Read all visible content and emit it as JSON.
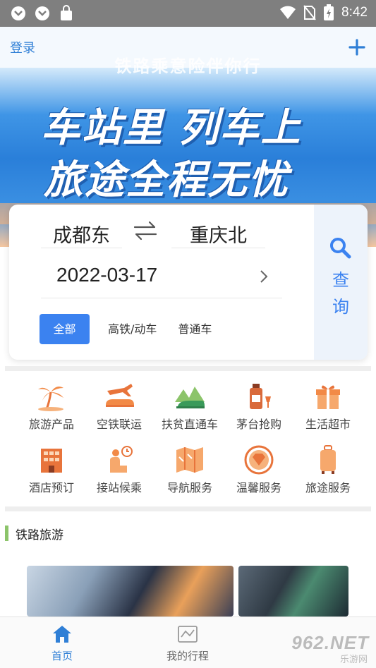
{
  "status_bar": {
    "time": "8:42"
  },
  "header": {
    "login_label": "登录"
  },
  "banner": {
    "tagline": "铁路乘意险伴你行",
    "slogan_line1": "车站里 列车上",
    "slogan_line2": "旅途全程无忧"
  },
  "search": {
    "from_station": "成都东",
    "to_station": "重庆北",
    "date": "2022-03-17",
    "train_types": [
      "全部",
      "高铁/动车",
      "普通车"
    ],
    "query_label_1": "查",
    "query_label_2": "询"
  },
  "services": [
    {
      "label": "旅游产品",
      "icon": "palm-tree-icon"
    },
    {
      "label": "空铁联运",
      "icon": "plane-train-icon"
    },
    {
      "label": "扶贫直通车",
      "icon": "train-mountains-icon"
    },
    {
      "label": "茅台抢购",
      "icon": "liquor-bottle-icon"
    },
    {
      "label": "生活超市",
      "icon": "gift-box-icon"
    },
    {
      "label": "酒店预订",
      "icon": "hotel-icon"
    },
    {
      "label": "接站候乘",
      "icon": "waiting-clock-icon"
    },
    {
      "label": "导航服务",
      "icon": "map-icon"
    },
    {
      "label": "温馨服务",
      "icon": "diamond-badge-icon"
    },
    {
      "label": "旅途服务",
      "icon": "suitcase-icon"
    }
  ],
  "section": {
    "title": "铁路旅游"
  },
  "bottom_nav": {
    "home": "首页",
    "trips": "我的行程"
  },
  "watermark": {
    "main": "962.NET",
    "sub": "乐游网"
  },
  "colors": {
    "accent": "#3b82f0",
    "link": "#2f7fd6",
    "section_marker": "#8cc46a"
  }
}
